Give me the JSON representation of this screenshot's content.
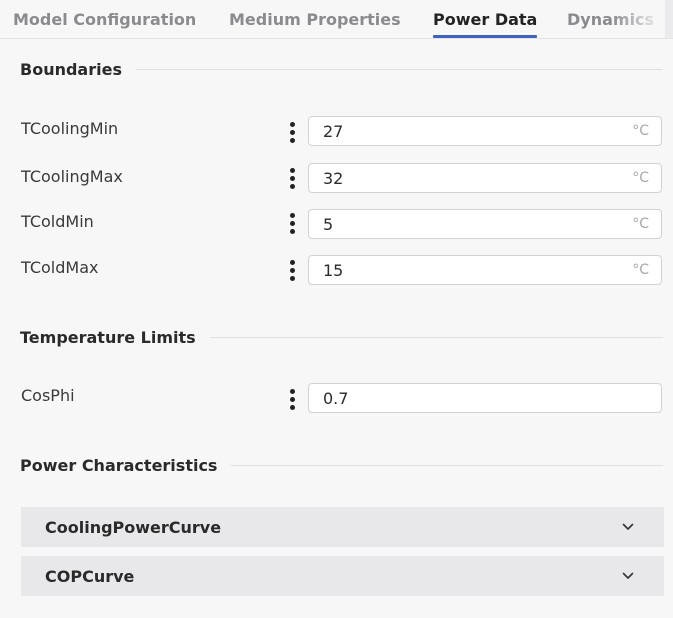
{
  "tabs": [
    {
      "label": "Model Configuration"
    },
    {
      "label": "Medium Properties"
    },
    {
      "label": "Power Data"
    },
    {
      "label": "Dynamics"
    }
  ],
  "active_tab": "Power Data",
  "sections": {
    "boundaries": {
      "title": "Boundaries",
      "fields": [
        {
          "label": "TCoolingMin",
          "value": "27",
          "unit": "°C"
        },
        {
          "label": "TCoolingMax",
          "value": "32",
          "unit": "°C"
        },
        {
          "label": "TColdMin",
          "value": "5",
          "unit": "°C"
        },
        {
          "label": "TColdMax",
          "value": "15",
          "unit": "°C"
        }
      ]
    },
    "temperature_limits": {
      "title": "Temperature Limits",
      "fields": [
        {
          "label": "CosPhi",
          "value": "0.7"
        }
      ]
    },
    "power_characteristics": {
      "title": "Power Characteristics",
      "accordions": [
        {
          "label": "CoolingPowerCurve"
        },
        {
          "label": "COPCurve"
        }
      ]
    }
  },
  "icons": {
    "field_menu": "kebab-menu-icon",
    "accordion_toggle": "chevron-down-icon"
  },
  "colors": {
    "active_tab_underline": "#3f63c4",
    "background": "#f7f7f8",
    "accordion_background": "#e8e8ea"
  }
}
